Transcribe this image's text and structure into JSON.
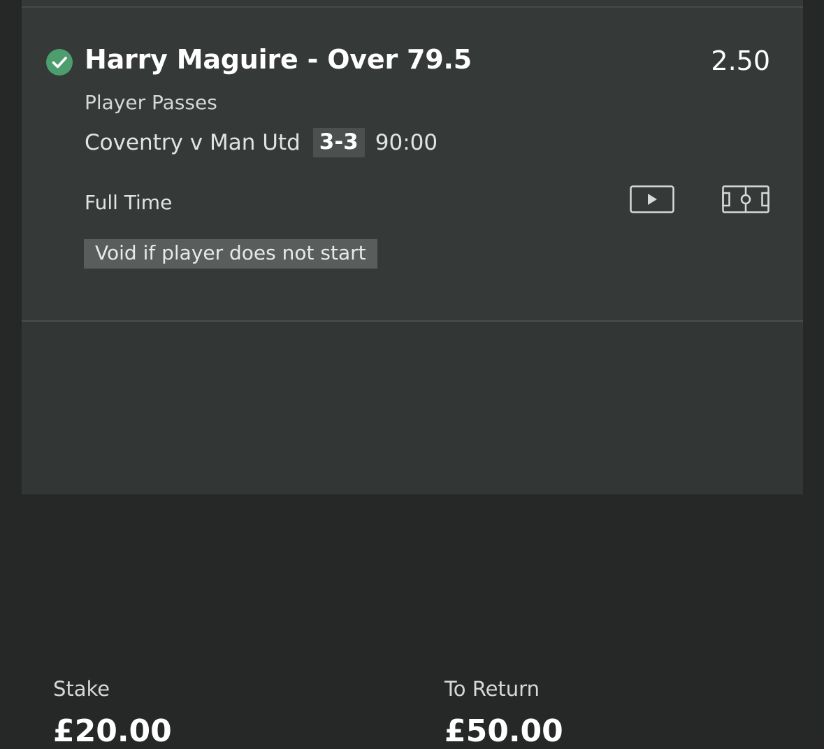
{
  "selection": {
    "status_icon": "check-circle-icon",
    "title": "Harry Maguire - Over 79.5",
    "odds": "2.50",
    "market": "Player Passes"
  },
  "event": {
    "name": "Coventry v Man Utd",
    "score": "3-3",
    "clock": "90:00",
    "status": "Full Time",
    "icons": [
      "video-play-icon",
      "pitch-icon"
    ]
  },
  "void_note": "Void if player does not start",
  "summary": {
    "stake_label": "Stake",
    "stake_value": "£20.00",
    "return_label": "To Return",
    "return_value": "£50.00"
  },
  "colors": {
    "win_green": "#4e9d6f",
    "card_bg": "#353937",
    "page_bg": "#262827"
  }
}
